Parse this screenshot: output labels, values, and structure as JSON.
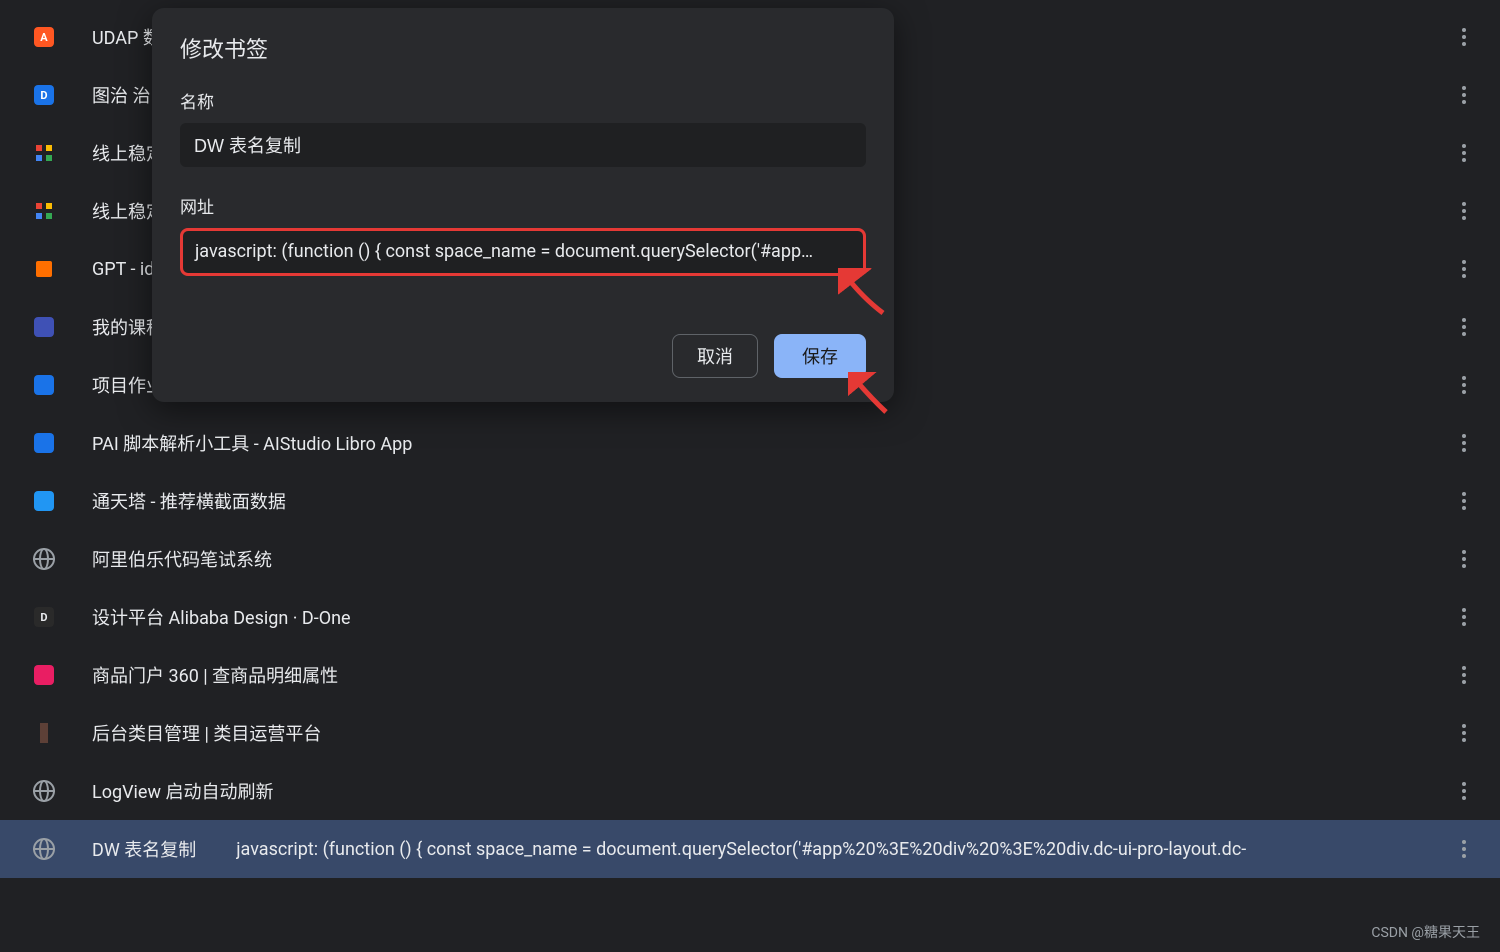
{
  "bookmarks": [
    {
      "title": "UDAP 数",
      "iconType": "fav",
      "iconColor": "#ff5722",
      "iconChar": "A"
    },
    {
      "title": "图治 治",
      "iconType": "fav-blue",
      "iconChar": "D"
    },
    {
      "title": "线上稳定",
      "iconType": "fav-multi"
    },
    {
      "title": "线上稳定",
      "iconType": "fav-multi"
    },
    {
      "title": "GPT - id",
      "iconType": "fav-orange"
    },
    {
      "title": "我的课程",
      "iconType": "fav",
      "iconColor": "#3f51b5"
    },
    {
      "title": "项目作业",
      "iconType": "fav",
      "iconColor": "#1a73e8"
    },
    {
      "title": "PAI 脚本解析小工具 - AIStudio Libro App",
      "iconType": "fav",
      "iconColor": "#1a73e8"
    },
    {
      "title": "通天塔 - 推荐横截面数据",
      "iconType": "fav",
      "iconColor": "#2196f3"
    },
    {
      "title": "阿里伯乐代码笔试系统",
      "iconType": "globe"
    },
    {
      "title": "设计平台 Alibaba Design · D-One",
      "iconType": "fav-d",
      "iconChar": "D"
    },
    {
      "title": "商品门户 360 | 查商品明细属性",
      "iconType": "fav",
      "iconColor": "#e91e63"
    },
    {
      "title": "后台类目管理  |  类目运营平台",
      "iconType": "fav-brown"
    },
    {
      "title": "LogView 启动自动刷新",
      "iconType": "globe"
    },
    {
      "title": "DW 表名复制",
      "iconType": "globe",
      "selected": true,
      "url": "javascript: (function () { const space_name = document.querySelector('#app%20%3E%20div%20%3E%20div.dc-ui-pro-layout.dc-"
    }
  ],
  "dialog": {
    "title": "修改书签",
    "name_label": "名称",
    "name_value": "DW 表名复制",
    "url_label": "网址",
    "url_value": "javascript: (function () {  const space_name = document.querySelector('#app…",
    "cancel": "取消",
    "save": "保存"
  },
  "watermark": "CSDN @糖果天王"
}
